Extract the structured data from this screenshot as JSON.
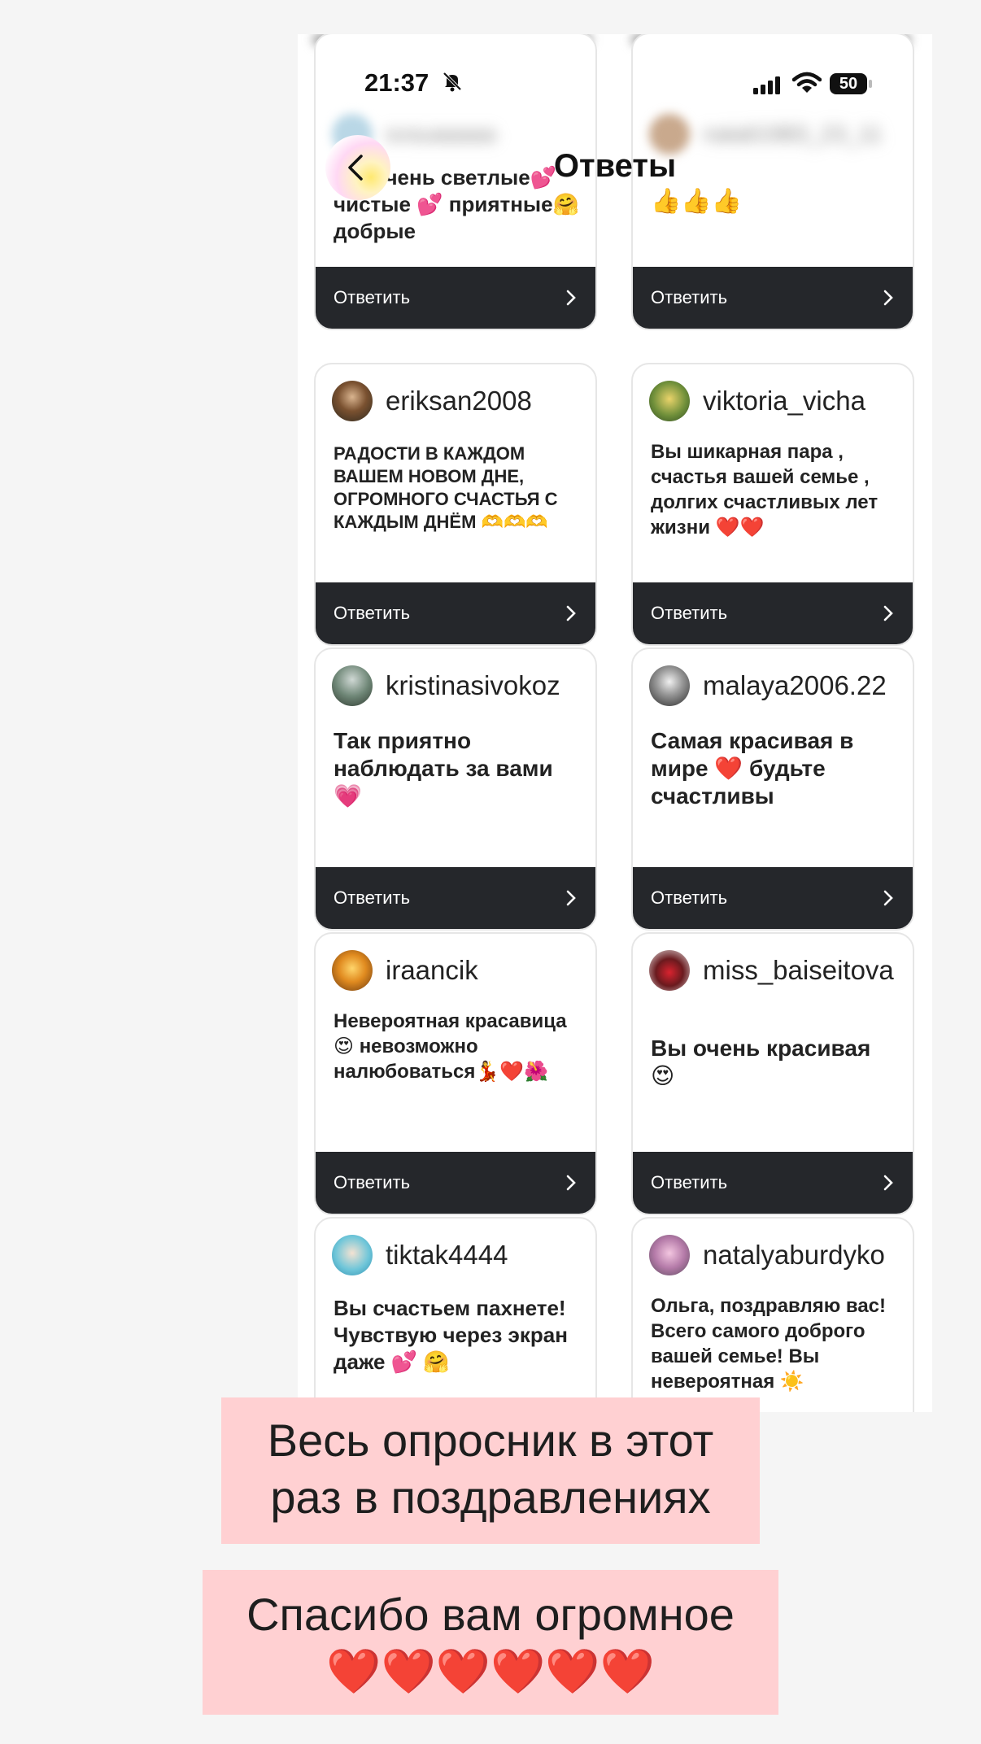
{
  "status": {
    "time": "21:37",
    "battery": "50"
  },
  "header": {
    "title": "Ответы"
  },
  "reply_label": "Ответить",
  "cards": [
    {
      "user": "",
      "message": "Вы очень светлые💕 чистые 💕 приятные🤗добрые"
    },
    {
      "user": "",
      "message": "👍👍👍"
    },
    {
      "user": "eriksan2008",
      "message": "РАДОСТИ В КАЖДОМ ВАШЕМ НОВОМ ДНЕ, ОГРОМНОГО СЧАСТЬЯ С КАЖДЫМ ДНЁМ 🫶🫶🫶"
    },
    {
      "user": "viktoria_vicha",
      "message": "Вы шикарная пара , счастья вашей семье , долгих счастливых лет жизни ❤️❤️"
    },
    {
      "user": "kristinasivokoz",
      "message": "Так приятно наблюдать за вами 💗"
    },
    {
      "user": "malaya2006.22",
      "message": "Самая красивая в мире ❤️ будьте счастливы"
    },
    {
      "user": "iraancik",
      "message": "Невероятная красавица 😍 невозможно налюбоваться💃❤️🌺"
    },
    {
      "user": "miss_baiseitova",
      "message": "Вы очень красивая 😍"
    },
    {
      "user": "tiktak4444",
      "message": "Вы счастьем пахнете! Чувствую через экран даже 💕 🤗"
    },
    {
      "user": "natalyaburdyko",
      "message": "Ольга, поздравляю вас! Всего самого доброго вашей семье! Вы невероятная ☀️"
    }
  ],
  "captions": {
    "first_line1": "Весь опросник в этот",
    "first_line2": "раз в поздравлениях",
    "second_line1": "Спасибо вам огромное",
    "second_line2": "❤️❤️❤️❤️❤️❤️"
  },
  "colors": {
    "reply_bar": "#25272b",
    "caption_bg": "#ffd0d2"
  }
}
